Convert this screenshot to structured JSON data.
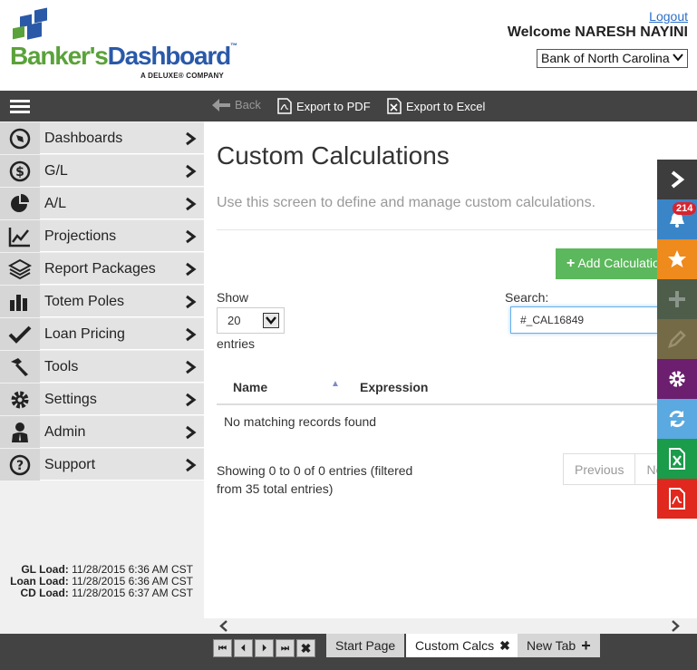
{
  "header": {
    "logo_part1": "Banker's",
    "logo_part2": "Dashboard",
    "logo_tm": "™",
    "logo_tagline": "A DELUXE® COMPANY",
    "logout_label": "Logout",
    "welcome_text": "Welcome  NARESH NAYINI",
    "bank_selected": "Bank of North Carolina"
  },
  "toolbar": {
    "back_label": "Back",
    "export_pdf_label": "Export to PDF",
    "export_excel_label": "Export to Excel"
  },
  "sidebar": {
    "items": [
      {
        "label": "Dashboards",
        "icon": "compass-icon"
      },
      {
        "label": "G/L",
        "icon": "dollar-icon"
      },
      {
        "label": "A/L",
        "icon": "pie-chart-icon"
      },
      {
        "label": "Projections",
        "icon": "line-chart-icon"
      },
      {
        "label": "Report Packages",
        "icon": "layers-icon"
      },
      {
        "label": "Totem Poles",
        "icon": "bar-chart-icon"
      },
      {
        "label": "Loan Pricing",
        "icon": "checkmark-icon"
      },
      {
        "label": "Tools",
        "icon": "hammer-icon"
      },
      {
        "label": "Settings",
        "icon": "gear-icon"
      },
      {
        "label": "Admin",
        "icon": "user-icon"
      },
      {
        "label": "Support",
        "icon": "question-icon"
      }
    ],
    "loads": {
      "gl_label": "GL Load:",
      "gl_value": "11/28/2015 6:36 AM CST",
      "loan_label": "Loan Load:",
      "loan_value": "11/28/2015 6:36 AM CST",
      "cd_label": "CD Load:",
      "cd_value": "11/28/2015 6:37 AM CST"
    }
  },
  "main": {
    "title": "Custom Calculations",
    "description": "Use this screen to define and manage custom calculations.",
    "add_button_label": "Add Calculation",
    "show_label": "Show",
    "page_length": "20",
    "entries_label": "entries",
    "search_label": "Search:",
    "search_value": "#_CAL16849",
    "columns": [
      "Name",
      "Expression"
    ],
    "empty_message": "No matching records found",
    "info_text": "Showing 0 to 0 of 0 entries (filtered from 35 total entries)",
    "pager_previous": "Previous",
    "pager_next": "Next"
  },
  "rail": {
    "notification_count": "214",
    "colors": {
      "arrow": "#3d3d3d",
      "notifications": "#3a85c8",
      "favorites": "#ef8a1c",
      "add": "#4d5d4a",
      "edit": "#746a45",
      "settings": "#6b1f6e",
      "refresh": "#5aa9e0",
      "excel": "#1a9c4a",
      "pdf": "#e0281e"
    }
  },
  "bottombar": {
    "tabs": [
      {
        "label": "Start Page"
      },
      {
        "label": "Custom Calcs"
      },
      {
        "label": "New Tab"
      }
    ]
  },
  "colors": {
    "brand_green": "#5aa23a",
    "brand_blue": "#2a59a8",
    "toolbar_bg": "#434343",
    "add_button": "#5cb85c"
  }
}
